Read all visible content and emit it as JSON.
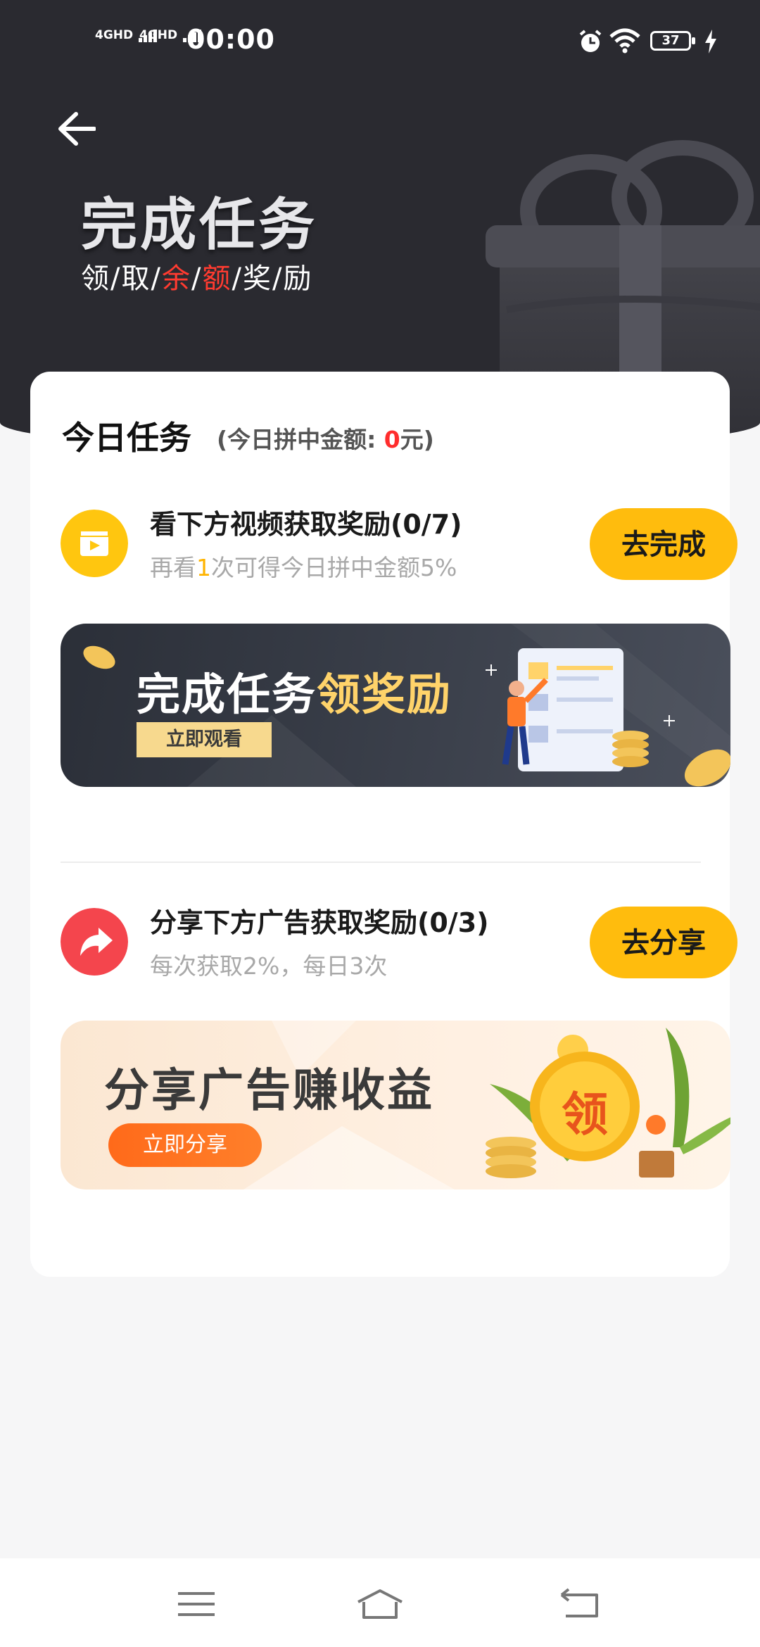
{
  "status_bar": {
    "signal1": "4GHD",
    "signal2": "4GHD",
    "time": "00:00",
    "battery": "37"
  },
  "header": {
    "title": "完成任务",
    "subtitle_parts": [
      "领",
      "/",
      "取",
      "/",
      "余",
      "/",
      "额",
      "/",
      "奖",
      "/",
      "励"
    ]
  },
  "card": {
    "title": "今日任务",
    "sub_prefix": "(今日拼中金额: ",
    "sub_amount": "0",
    "sub_suffix": "元)",
    "task1": {
      "name": "看下方视频获取奖励(0/7)",
      "desc_prefix": "再看",
      "desc_highlight": "1",
      "desc_suffix": "次可得今日拼中金额5%",
      "button": "去完成"
    },
    "banner1": {
      "text_white": "完成任务",
      "text_gold": "领奖励",
      "button": "立即观看"
    },
    "task2": {
      "name": "分享下方广告获取奖励(0/3)",
      "desc": "每次获取2%，每日3次",
      "button": "去分享"
    },
    "banner2": {
      "text": "分享广告赚收益",
      "button": "立即分享",
      "coin_text": "领"
    }
  },
  "colors": {
    "header_bg": "#2a2a30",
    "accent_yellow": "#ffbc0d",
    "red": "#ff3b30",
    "share_icon_red": "#f4454d",
    "orange_button": "#ff6a1a"
  }
}
